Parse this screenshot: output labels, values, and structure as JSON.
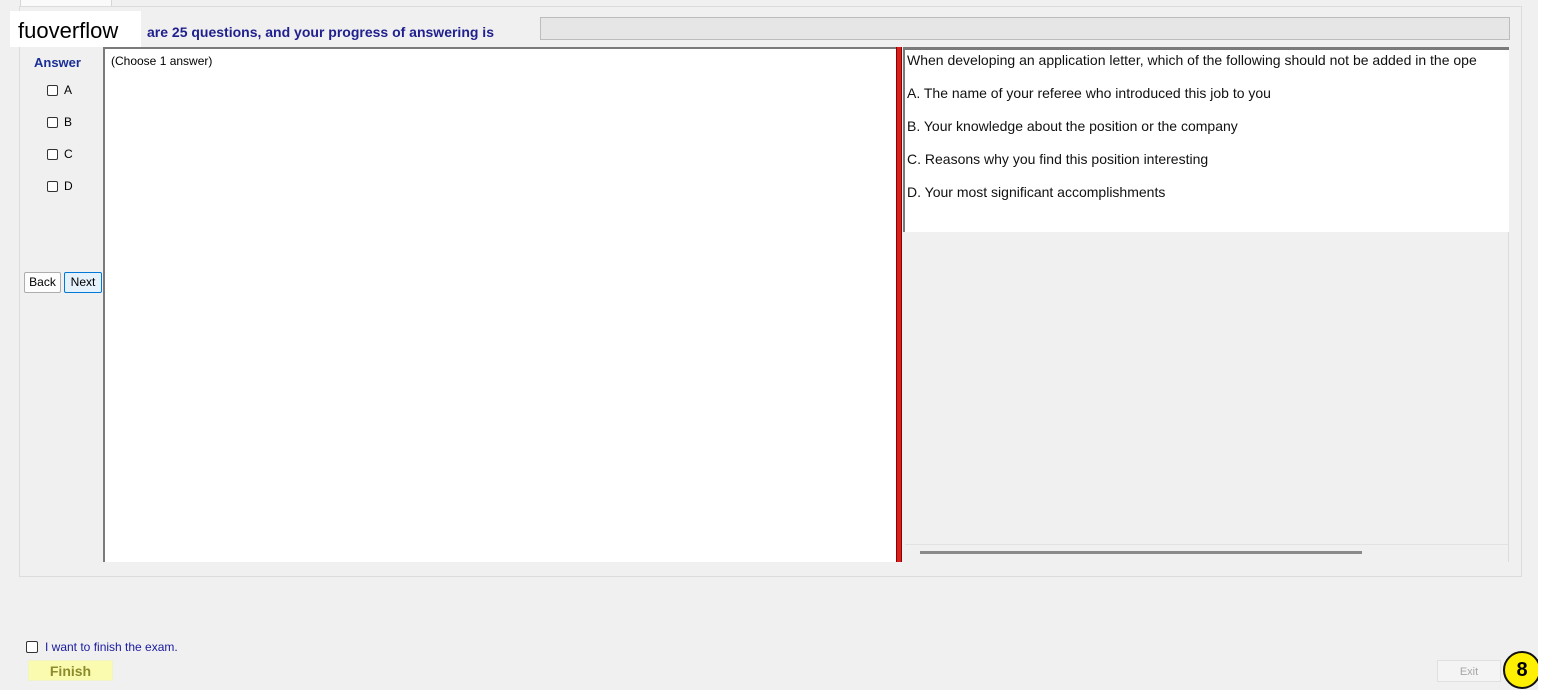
{
  "watermark": "fuoverflow",
  "progress": {
    "text": "are 25 questions, and your progress of answering is",
    "fraction": 0
  },
  "answer": {
    "title": "Answer",
    "options": [
      "A",
      "B",
      "C",
      "D"
    ]
  },
  "nav": {
    "back_label": "Back",
    "next_label": "Next"
  },
  "answer_panel": {
    "hint": "(Choose 1 answer)"
  },
  "question": {
    "text": "When developing an application letter, which of the following should not be added in the ope",
    "choices": [
      "A.  The name of your referee who introduced this job to you",
      "B.  Your knowledge about the position or the company",
      "C.  Reasons why you find this position interesting",
      "D.  Your most significant accomplishments"
    ]
  },
  "footer": {
    "finish_check_label": "I want to finish the exam.",
    "finish_label": "Finish",
    "exit_label": "Exit",
    "badge": "8"
  },
  "colors": {
    "title_blue": "#1a2f96",
    "splitter_red": "#d8201c",
    "finish_bg": "#fbfbb0",
    "badge_yellow": "#ffef00"
  }
}
